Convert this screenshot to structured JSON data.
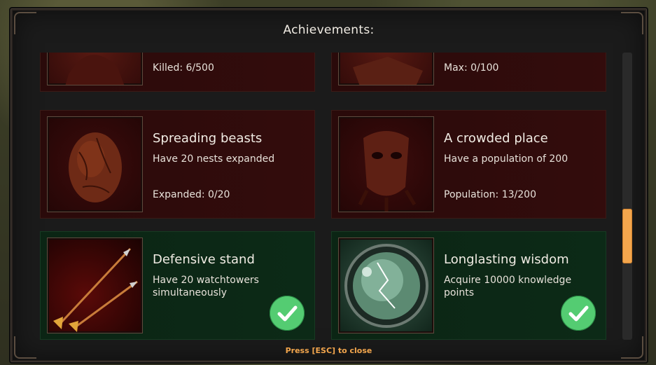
{
  "title": "Achievements:",
  "footer": "Press [ESC] to close",
  "colors": {
    "accent": "#f3a64d",
    "complete_check": "#54cc72",
    "card_locked": "#330c0c",
    "card_complete": "#0c2a17"
  },
  "cards": [
    {
      "title": "",
      "description": "",
      "progress": "Killed: 6/500",
      "completed": false,
      "icon": "creature-icon"
    },
    {
      "title": "",
      "description": "",
      "progress": "Max: 0/100",
      "completed": false,
      "icon": "goods-icon"
    },
    {
      "title": "Spreading beasts",
      "description": "Have 20 nests expanded",
      "progress": "Expanded: 0/20",
      "completed": false,
      "icon": "egg-icon"
    },
    {
      "title": "A crowded place",
      "description": "Have a population of 200",
      "progress": "Population: 13/200",
      "completed": false,
      "icon": "tribal-mask-icon"
    },
    {
      "title": "Defensive stand",
      "description": "Have 20 watchtowers simultaneously",
      "progress": "",
      "completed": true,
      "icon": "arrows-icon"
    },
    {
      "title": "Longlasting wisdom",
      "description": "Acquire 10000 knowledge points",
      "progress": "",
      "completed": true,
      "icon": "crystal-orb-icon"
    }
  ],
  "scroll": {
    "position_fraction": 0.62
  }
}
